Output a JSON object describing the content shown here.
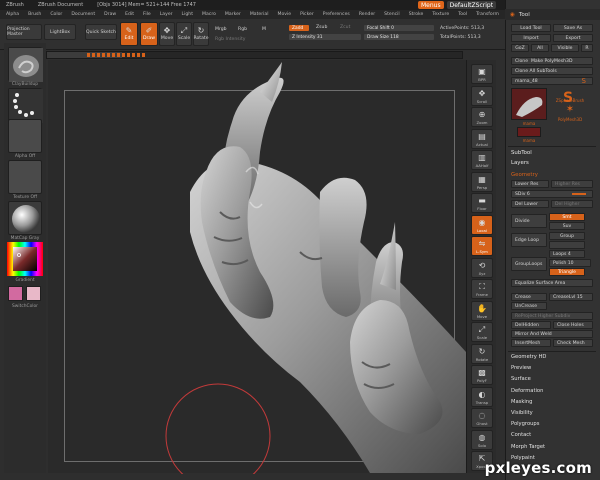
{
  "titlebar": {
    "app": "ZBrush",
    "doc_name": "ZBrush Document",
    "stats": "[Objs 3014] Mem= 521+144 Free 1747",
    "menus_label": "Menus",
    "script_label": "DefaultZScript"
  },
  "menubar": [
    "Alpha",
    "Brush",
    "Color",
    "Document",
    "Draw",
    "Edit",
    "File",
    "Layer",
    "Light",
    "Macro",
    "Marker",
    "Material",
    "Movie",
    "Picker",
    "Preferences",
    "Render",
    "Stencil",
    "Stroke",
    "Texture",
    "Tool",
    "Transform",
    "Zoom",
    "Zplugin",
    "Zscript"
  ],
  "shelf": {
    "projection_master": "Projection Master",
    "lightbox": "LightBox",
    "quick_sketch": "Quick Sketch",
    "edit": "Edit",
    "draw": "Draw",
    "move": "Move",
    "scale": "Scale",
    "rotate": "Rotate",
    "mrgb": "Mrgb",
    "rgb": "Rgb",
    "m": "M",
    "rgb_intensity": "Rgb Intensity",
    "zadd": "Zadd",
    "zsub": "Zsub",
    "zcut": "Zcut",
    "z_intensity": "Z Intensity 31",
    "focal_shift": "Focal Shift 0",
    "draw_size": "Draw Size 118",
    "active_points": "ActivePoints: 513,3",
    "total_points": "TotalPoints: 513,3"
  },
  "camera": {
    "label": "Camera",
    "position": 0.18
  },
  "left_shelf": {
    "brush_label": "ClayBuildup",
    "stroke_label": "Dots",
    "alpha_label": "Alpha Off",
    "texture_label": "Texture Off",
    "material_label": "MatCap Gray",
    "gradient_label": "Gradient",
    "switch_label": "SwitchColor"
  },
  "vshelf": [
    {
      "label": "BPR",
      "glyph": "▣"
    },
    {
      "label": "Scroll",
      "glyph": "✥"
    },
    {
      "label": "Zoom",
      "glyph": "⊕"
    },
    {
      "label": "Actual",
      "glyph": "▤"
    },
    {
      "label": "AAHalf",
      "glyph": "▥"
    },
    {
      "label": "Persp",
      "glyph": "▦"
    },
    {
      "label": "Floor",
      "glyph": "▬"
    },
    {
      "label": "Local",
      "glyph": "◉"
    },
    {
      "label": "L.Sym",
      "glyph": "⇋"
    },
    {
      "label": "Xyz",
      "glyph": "⟲"
    },
    {
      "label": "Frame",
      "glyph": "⛶"
    },
    {
      "label": "Move",
      "glyph": "✋"
    },
    {
      "label": "Scale",
      "glyph": "⤢"
    },
    {
      "label": "Rotate",
      "glyph": "↻"
    },
    {
      "label": "PolyF",
      "glyph": "▩"
    },
    {
      "label": "Transp",
      "glyph": "◐"
    },
    {
      "label": "Ghost",
      "glyph": "◌"
    },
    {
      "label": "Solo",
      "glyph": "◍"
    },
    {
      "label": "Xpose",
      "glyph": "⇱"
    }
  ],
  "palette": {
    "title": "Tool",
    "load_tool": "Load Tool",
    "save_as": "Save As",
    "import": "Import",
    "export": "Export",
    "goz": "GoZ",
    "all": "All",
    "visible": "Visible",
    "r": "R",
    "clone": "Clone",
    "make_polymesh": "Make PolyMesh3D",
    "clone_all": "Clone All SubTools",
    "mama": "mama_48",
    "tool_zsphere": "ZSphereBrush",
    "tool_poly": "PolyMesh3D",
    "tool_mama": "mama",
    "tool_hand": "mama",
    "subtool": "SubTool",
    "layers": "Layers",
    "geometry": "Geometry",
    "lower_res": "Lower Res",
    "higher_res": "Higher Res",
    "sdiv": "SDiv 6",
    "del_lower": "Del Lower",
    "del_higher": "Del Higher",
    "divide": "Divide",
    "smt": "Smt",
    "suv": "Suv",
    "edge_loop": "Edge Loop",
    "group": "Group",
    "polish": "Polish 10",
    "loops": "Loops 4",
    "grouploops": "GroupLoops",
    "triangle": "Triangle",
    "equalize": "Equalize Surface Area",
    "crease": "Crease",
    "creaselvl": "CreaseLvl 15",
    "uncrease": "UnCrease",
    "reproject": "ReProject Higher Subdiv",
    "delhidden": "DelHidden",
    "close_holes": "Close Holes",
    "mirror_weld": "Mirror And Weld",
    "insertmesh": "InsertMesh",
    "check_mesh": "Check Mesh",
    "sections": [
      "Geometry HD",
      "Preview",
      "Surface",
      "Deformation",
      "Masking",
      "Visibility",
      "Polygroups",
      "Contact",
      "Morph Target",
      "Polypaint"
    ]
  },
  "watermark": "pxleyes.com",
  "colors": {
    "accent": "#d7621a",
    "panel": "#323232",
    "canvas": "#2a2a2a"
  }
}
